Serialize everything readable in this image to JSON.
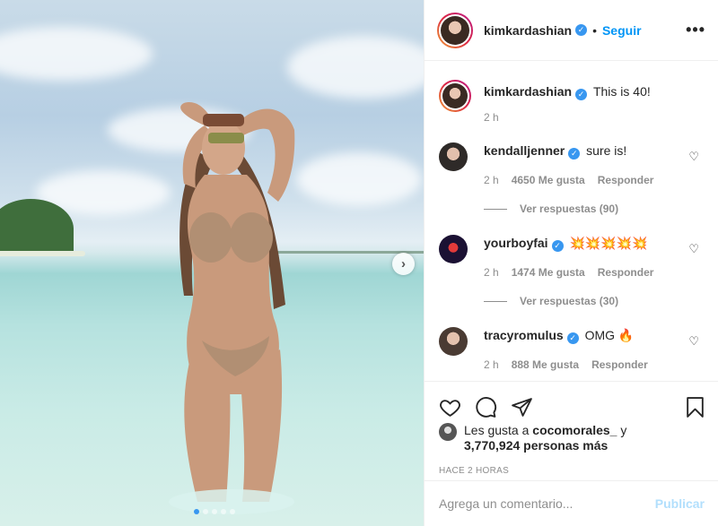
{
  "post": {
    "username": "kimkardashian",
    "follow_label": "Seguir",
    "separator": "•",
    "more_label": "•••",
    "caption": "This is 40!",
    "caption_time": "2 h"
  },
  "comments": [
    {
      "user": "kendalljenner",
      "text": "sure is!",
      "time": "2 h",
      "likes": "4650 Me gusta",
      "reply": "Responder",
      "view_replies": "Ver respuestas (90)"
    },
    {
      "user": "yourboyfai",
      "text": "💥💥💥💥💥",
      "time": "2 h",
      "likes": "1474 Me gusta",
      "reply": "Responder",
      "view_replies": "Ver respuestas (30)"
    },
    {
      "user": "tracyromulus",
      "text": "OMG 🔥",
      "time": "2 h",
      "likes": "888 Me gusta",
      "reply": "Responder"
    }
  ],
  "likes": {
    "prefix": "Les gusta a",
    "user": "cocomorales_",
    "join": "y",
    "count": "3,770,924 personas más"
  },
  "timestamp": "HACE 2 HORAS",
  "composer": {
    "placeholder": "Agrega un comentario...",
    "post_label": "Publicar"
  },
  "carousel": {
    "slides": 5,
    "active": 1
  },
  "colors": {
    "follow": "#0095f6",
    "verified": "#3897f0",
    "muted": "#8e8e8e",
    "post_disabled": "#b2dffc"
  },
  "icons": [
    "heart-icon",
    "comment-icon",
    "share-icon",
    "bookmark-icon",
    "verified-icon",
    "next-arrow-icon"
  ]
}
